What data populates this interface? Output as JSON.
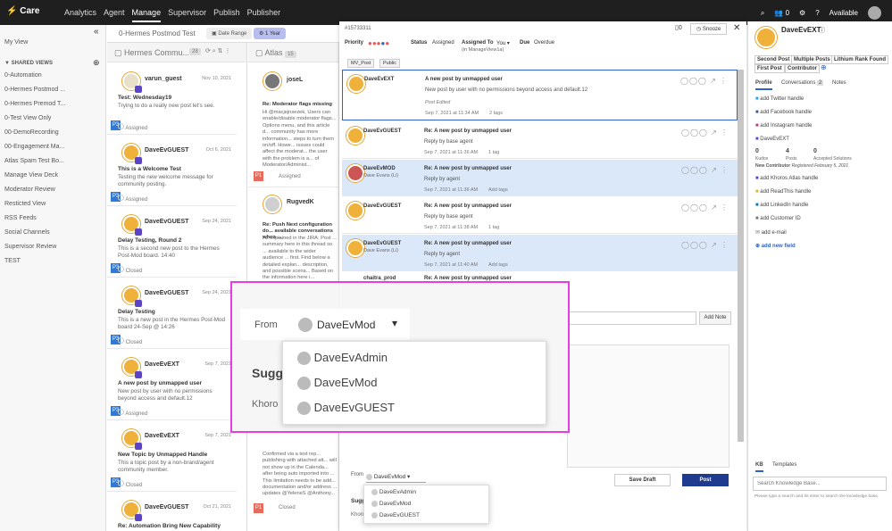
{
  "topbar": {
    "brand": "Care",
    "nav": [
      "Analytics",
      "Agent",
      "Manage",
      "Supervisor",
      "Publish",
      "Publisher"
    ],
    "active_nav": "Manage",
    "notification_count": "0",
    "status": "Available"
  },
  "sidebar": {
    "my_view": "My View",
    "shared_title": "SHARED VIEWS",
    "items": [
      "0-Automation",
      "0-Hermes Postmod ...",
      "0-Hermes Premod T...",
      "0-Test View Only",
      "00-DemoRecording",
      "00-Engagement Ma...",
      "Atlas Spam Test Bo...",
      "Manage View Deck",
      "Moderator Review",
      "Resticted View",
      "RSS Feeds",
      "Social Channels",
      "Supervisor Review",
      "TEST"
    ]
  },
  "view": {
    "title": "0-Hermes Postmod Test",
    "date_range": "Date Range",
    "year": "1 Year"
  },
  "column1": {
    "title": "Hermes Commu...",
    "count": "28",
    "cards": [
      {
        "name": "varun_guest",
        "date": "Nov 10, 2021",
        "subject": "Test: Wednesday19",
        "body": "Trying to do a really new post let's see.",
        "status": "Assigned",
        "priority": "P3"
      },
      {
        "name": "DaveEvGUEST",
        "date": "Oct 6, 2021",
        "subject": "This is a Welcome Test",
        "body": "Testing the new welcome message for community posting.",
        "status": "Assigned",
        "priority": "P3"
      },
      {
        "name": "DaveEvGUEST",
        "date": "Sep 24, 2021",
        "subject": "Delay Testing, Round 2",
        "body": "This is a second new post to the Hermes Post-Mod board. 14:40",
        "status": "Closed",
        "priority": "P3"
      },
      {
        "name": "DaveEvGUEST",
        "date": "Sep 24, 2021",
        "subject": "Delay Testing",
        "body": "This is a new post in the Hermes Post-Mod board 24-Sep @ 14:26",
        "status": "Closed",
        "priority": "P3"
      },
      {
        "name": "DaveEvEXT",
        "date": "Sep 7, 2021",
        "subject": "A new post by unmapped user",
        "body": "New post by user with no permissions beyond access and default.12",
        "status": "Assigned",
        "priority": "P3"
      },
      {
        "name": "DaveEvEXT",
        "date": "Sep 7, 2021",
        "subject": "New Topic by Unmapped Handle",
        "body": "This a topic post by a non-brand/agent community member.",
        "status": "Closed",
        "priority": "P3"
      },
      {
        "name": "DaveEvGUEST",
        "date": "Oct 21, 2021",
        "subject": "Re: Automation Bring New Capability",
        "body": "",
        "status": "",
        "priority": ""
      }
    ]
  },
  "column2": {
    "title": "Atlas",
    "count": "15",
    "cards": [
      {
        "name": "joseL",
        "subject": "Re: Moderator flags missing",
        "body": "Hi @macjejnsezek,  Users can enable/disable moderator flags... Options menu, and this article d... community has more information... steps to turn them on/off. Howe... issues could affect the moderat... the user with the problem is a... of Moderator/Administ...",
        "status": "Assigned",
        "priority": "P1"
      },
      {
        "name": "RugvedK",
        "subject": "Re: Push Next configuration do... available conversations when ...",
        "body": "As explained in the JIRA: Post ... summary here in this thread so ... available to the wider audience ... first. Find below a detailed explan... description, and possible scena... Based on the information here i...",
        "status": "",
        "priority": "P1"
      },
      {
        "name": "",
        "subject": "",
        "body": "Confirmed via a test rep... publishing with attached att... will not show up in the Calenda... after being auto imported into ... This limitation needs to be add... documentation and/or address ... updates @YeleneS @Anthony...",
        "status": "Closed",
        "priority": "P1"
      }
    ]
  },
  "modal": {
    "id": "#15733311",
    "snooze": "Snooze",
    "priority_label": "Priority",
    "status_label": "Status",
    "status_value": "Assigned",
    "assigned_label": "Assigned To",
    "assigned_value": "You",
    "assigned_sub": "(in ManageView1a)",
    "due_label": "Due",
    "due_value": "Overdue",
    "tags": [
      "MV_Post",
      "Public"
    ],
    "posts": [
      {
        "author": "DaveEvEXT",
        "sub": "",
        "title": "A new post by unmapped user",
        "body": "New post by user with no permissions beyond access and default.12",
        "extra": "Post Edited",
        "date": "Sep 7, 2021 at 11:34 AM",
        "tags": "2 tags"
      },
      {
        "author": "DaveEvGUEST",
        "sub": "",
        "title": "Re: A new post by unmapped user",
        "body": "Reply by base agent",
        "extra": "",
        "date": "Sep 7, 2021 at 11:36 AM",
        "tags": "1 tag"
      },
      {
        "author": "DaveEvMOD",
        "sub": "Dave Evans (Li)",
        "title": "Re: A new post by unmapped user",
        "body": "Reply by agent",
        "extra": "",
        "date": "Sep 7, 2021 at 11:36 AM",
        "tags": "Add tags"
      },
      {
        "author": "DaveEvGUEST",
        "sub": "",
        "title": "Re: A new post by unmapped user",
        "body": "Reply by base agent",
        "extra": "",
        "date": "Sep 7, 2021 at 11:38 AM",
        "tags": "1 tag"
      },
      {
        "author": "DaveEvGUEST",
        "sub": "Dave Evans (Li)",
        "title": "Re: A new post by unmapped user",
        "body": "Reply by agent",
        "extra": "",
        "date": "Sep 7, 2021 at 11:40 AM",
        "tags": "Add tags"
      },
      {
        "author": "chaitra_prod",
        "sub": "",
        "title": "Re: A new post by unmapped user",
        "body": "",
        "extra": "",
        "date": "",
        "tags": ""
      }
    ],
    "add_note": "Add Note",
    "from_label": "From",
    "from_value": "DaveEvMod",
    "suggestions": "Sugg",
    "khoros": "Khoro",
    "save_draft": "Save Draft",
    "post": "Post",
    "from_options": [
      "DaveEvAdmin",
      "DaveEvMod",
      "DaveEvGUEST"
    ]
  },
  "profile": {
    "name": "DaveEvEXT",
    "badges": [
      "Second Post",
      "Multiple Posts",
      "Lithium Rank Found",
      "First Post",
      "Contributor"
    ],
    "tabs": [
      "Profile",
      "Conversations",
      "Notes"
    ],
    "conversations_count": "2",
    "links": [
      "add Twitter handle",
      "add Facebook handle",
      "add Instagram handle",
      "DaveEvEXT"
    ],
    "stats": [
      {
        "value": "0",
        "label": "Kudos"
      },
      {
        "value": "4",
        "label": "Posts"
      },
      {
        "value": "0",
        "label": "Accepted Solutions"
      }
    ],
    "contributor_label": "New Contributor",
    "registered": "Registered February 5, 2021",
    "more_links": [
      "add Khoros Atlas handle",
      "add ReadThis handle",
      "add LinkedIn handle",
      "add Customer ID",
      "add e-mail",
      "add new field"
    ],
    "kb_tabs": [
      "KB",
      "Templates"
    ],
    "kb_placeholder": "Search Knowledge Base...",
    "kb_hint": "Please type a search and hit enter to search the knowledge base."
  },
  "overlay_callout": {
    "from_label": "From",
    "from_value": "DaveEvMod",
    "options": [
      "DaveEvAdmin",
      "DaveEvMod",
      "DaveEvGUEST"
    ],
    "suggestions_partial": "Sugg",
    "khoros_partial": "Khoro"
  },
  "colors": {
    "accent": "#2f63c8",
    "magenta": "#e63ee3",
    "topbar": "#1f1f1f",
    "selected": "#dbe8fa"
  }
}
